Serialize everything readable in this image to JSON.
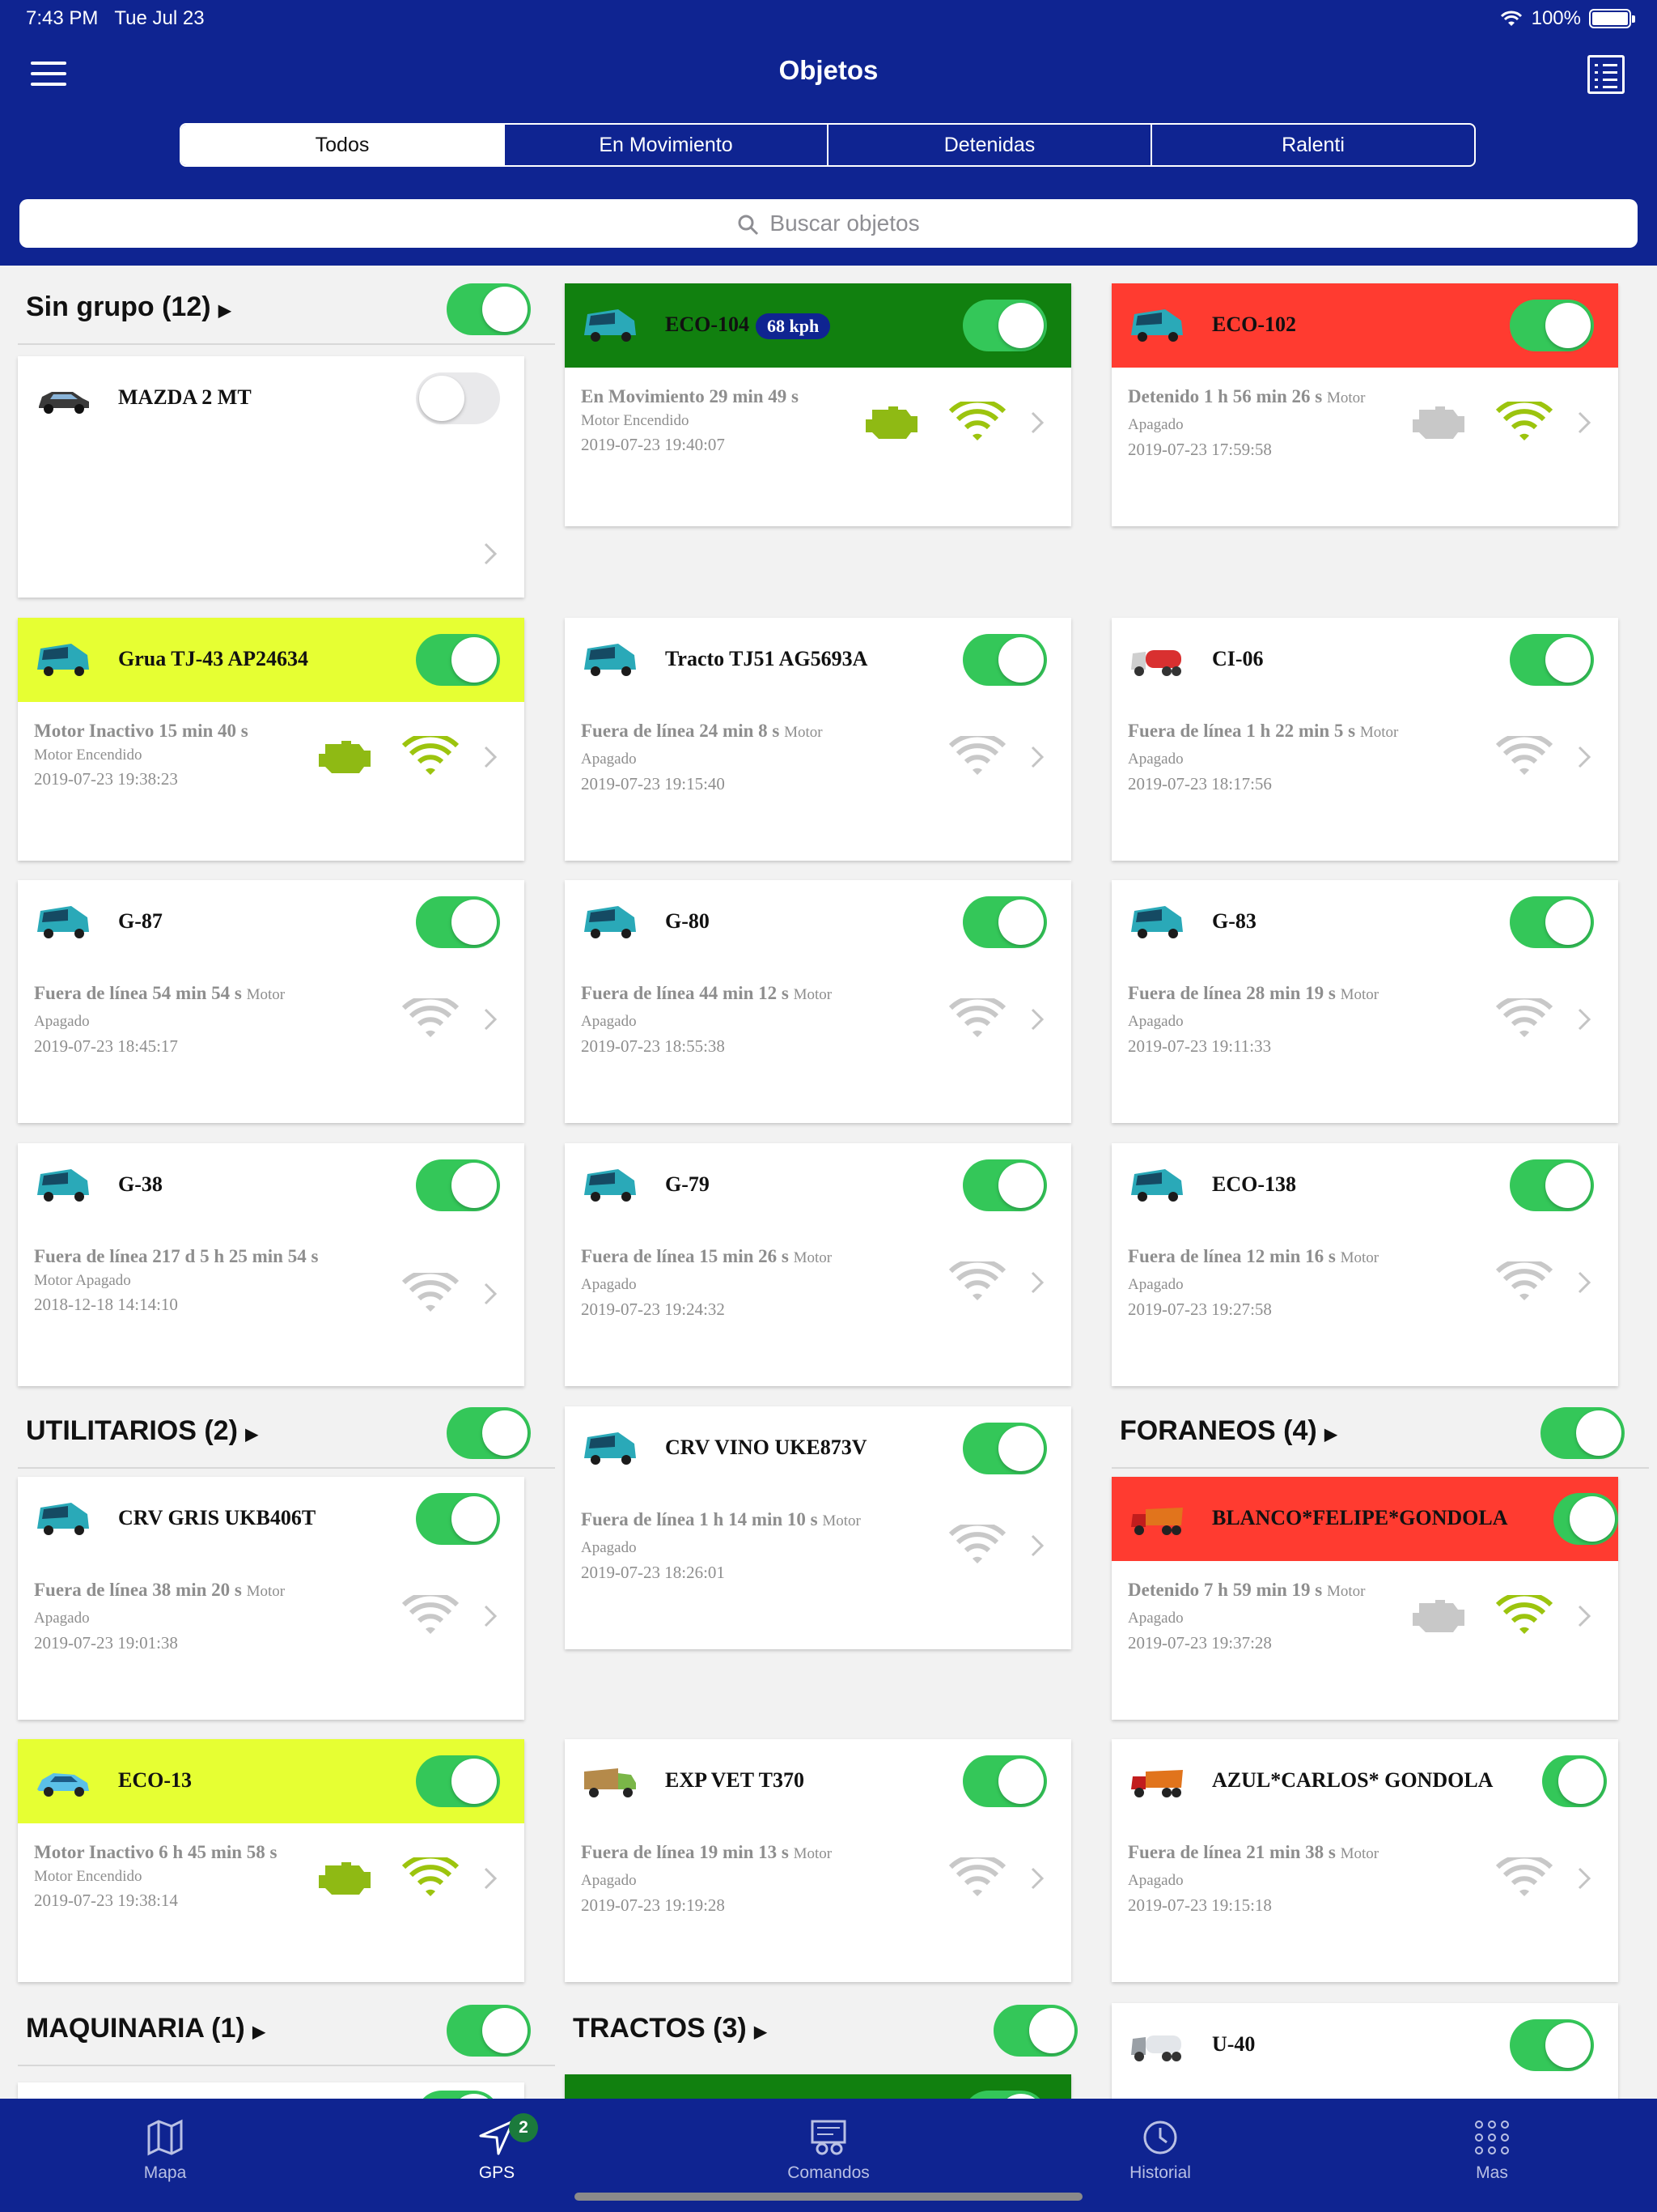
{
  "status_bar": {
    "time": "7:43 PM",
    "date": "Tue Jul 23",
    "battery": "100%"
  },
  "header": {
    "title": "Objetos"
  },
  "segments": [
    "Todos",
    "En Movimiento",
    "Detenidas",
    "Ralenti"
  ],
  "search": {
    "placeholder": "Buscar objetos"
  },
  "groups": [
    {
      "label": "Sin grupo (12)"
    },
    {
      "label": "UTILITARIOS (2)"
    },
    {
      "label": "FORANEOS (4)"
    },
    {
      "label": "MAQUINARIA (1)"
    },
    {
      "label": "TRACTOS (3)"
    }
  ],
  "colors": {
    "header": "#0f2491",
    "moving": "#11800f",
    "stopped": "#ff3b30",
    "idle": "#e6ff33",
    "toggle_on": "#34c759",
    "engine_on": "#8fba14",
    "signal_on": "#9cc40e",
    "muted": "#c8c8c8"
  },
  "cards": [
    {
      "name": "MAZDA 2 MT",
      "status": "",
      "engine": "",
      "time": "",
      "speed": ""
    },
    {
      "name": "ECO-104",
      "speed": "68 kph",
      "status": "En Movimiento 29 min 49 s",
      "engine": "Motor Encendido",
      "time": "2019-07-23 19:40:07"
    },
    {
      "name": "ECO-102",
      "speed": "",
      "status": "Detenido 1 h 56 min 26 s",
      "engine": "Motor Apagado",
      "time": "2019-07-23 17:59:58"
    },
    {
      "name": "Grua TJ-43 AP24634",
      "speed": "",
      "status": "Motor Inactivo 15 min 40 s",
      "engine": "Motor Encendido",
      "time": "2019-07-23 19:38:23"
    },
    {
      "name": "Tracto TJ51 AG5693A",
      "speed": "",
      "status": "Fuera de línea 24 min 8 s",
      "engine": "Motor Apagado",
      "time": "2019-07-23 19:15:40"
    },
    {
      "name": "CI-06",
      "speed": "",
      "status": "Fuera de línea 1 h 22 min 5 s",
      "engine": "Motor Apagado",
      "time": "2019-07-23 18:17:56"
    },
    {
      "name": "G-87",
      "speed": "",
      "status": "Fuera de línea 54 min 54 s",
      "engine": "Motor Apagado",
      "time": "2019-07-23 18:45:17"
    },
    {
      "name": "G-80",
      "speed": "",
      "status": "Fuera de línea 44 min 12 s",
      "engine": "Motor Apagado",
      "time": "2019-07-23 18:55:38"
    },
    {
      "name": "G-83",
      "speed": "",
      "status": "Fuera de línea 28 min 19 s",
      "engine": "Motor Apagado",
      "time": "2019-07-23 19:11:33"
    },
    {
      "name": "G-38",
      "speed": "",
      "status": "Fuera de línea 217 d 5 h 25 min 54 s",
      "engine": "Motor Apagado",
      "time": "2018-12-18 14:14:10"
    },
    {
      "name": "G-79",
      "speed": "",
      "status": "Fuera de línea 15 min 26 s",
      "engine": "Motor Apagado",
      "time": "2019-07-23 19:24:32"
    },
    {
      "name": "ECO-138",
      "speed": "",
      "status": "Fuera de línea 12 min 16 s",
      "engine": "Motor Apagado",
      "time": "2019-07-23 19:27:58"
    },
    {
      "name": "CRV VINO UKE873V",
      "speed": "",
      "status": "Fuera de línea 1 h 14 min 10 s",
      "engine": "Motor Apagado",
      "time": "2019-07-23 18:26:01"
    },
    {
      "name": "CRV GRIS UKB406T",
      "speed": "",
      "status": "Fuera de línea 38 min 20 s",
      "engine": "Motor Apagado",
      "time": "2019-07-23 19:01:38"
    },
    {
      "name": "BLANCO*FELIPE*GONDOLA",
      "speed": "",
      "status": "Detenido 7 h 59 min 19 s",
      "engine": "Motor Apagado",
      "time": "2019-07-23 19:37:28"
    },
    {
      "name": "ECO-13",
      "speed": "",
      "status": "Motor Inactivo 6 h 45 min 58 s",
      "engine": "Motor Encendido",
      "time": "2019-07-23 19:38:14"
    },
    {
      "name": "EXP VET T370",
      "speed": "",
      "status": "Fuera de línea 19 min 13 s",
      "engine": "Motor Apagado",
      "time": "2019-07-23 19:19:28"
    },
    {
      "name": "AZUL*CARLOS* GONDOLA",
      "speed": "",
      "status": "Fuera de línea 21 min 38 s",
      "engine": "Motor Apagado",
      "time": "2019-07-23 19:15:18"
    },
    {
      "name": "U-40",
      "speed": "",
      "status": "",
      "engine": "",
      "time": ""
    }
  ],
  "tabbar": [
    {
      "label": "Mapa",
      "icon": "map-icon"
    },
    {
      "label": "GPS",
      "icon": "navigation-arrow-icon",
      "badge": "2"
    },
    {
      "label": "Comandos",
      "icon": "commands-icon"
    },
    {
      "label": "Historial",
      "icon": "history-icon"
    },
    {
      "label": "Mas",
      "icon": "grid-dots-icon"
    }
  ]
}
